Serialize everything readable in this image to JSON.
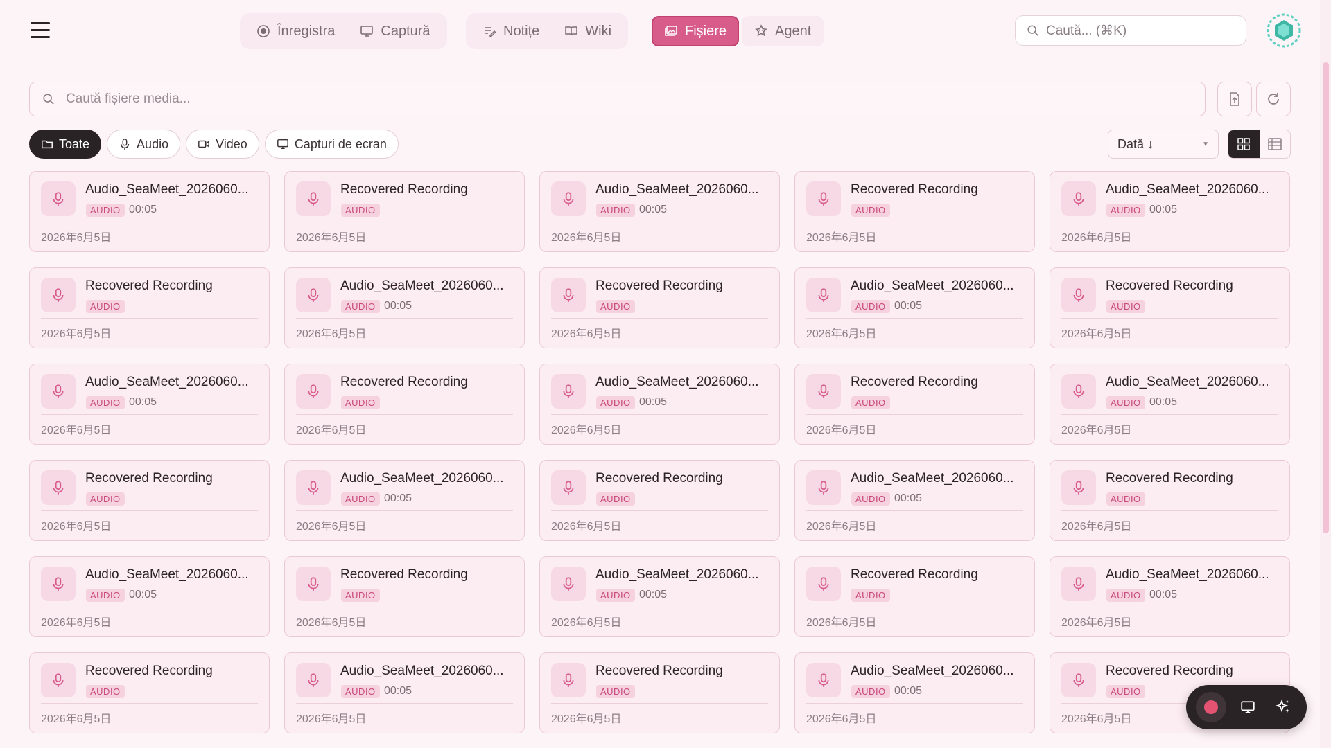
{
  "nav": {
    "groups": [
      [
        {
          "label": "Înregistra",
          "icon": "record-icon"
        },
        {
          "label": "Captură",
          "icon": "monitor-icon"
        }
      ],
      [
        {
          "label": "Notițe",
          "icon": "notes-icon"
        },
        {
          "label": "Wiki",
          "icon": "book-icon"
        }
      ],
      [
        {
          "label": "Fișiere",
          "icon": "folder-images-icon",
          "active": true
        },
        {
          "label": "Agent",
          "icon": "robot-icon"
        }
      ]
    ],
    "search_placeholder": "Caută... (⌘K)"
  },
  "media": {
    "search_placeholder": "Caută fișiere media...",
    "filters": [
      {
        "label": "Toate",
        "icon": "folder-icon",
        "active": true
      },
      {
        "label": "Audio",
        "icon": "mic-icon"
      },
      {
        "label": "Video",
        "icon": "video-icon"
      },
      {
        "label": "Capturi de ecran",
        "icon": "monitor-icon"
      }
    ],
    "sort_label": "Dată ↓",
    "view_modes": [
      "grid",
      "list"
    ],
    "active_view": "grid"
  },
  "files": [
    {
      "title": "Audio_SeaMeet_2026060...",
      "type": "AUDIO",
      "duration": "00:05",
      "date": "2026年6月5日"
    },
    {
      "title": "Recovered Recording",
      "type": "AUDIO",
      "duration": "",
      "date": "2026年6月5日"
    },
    {
      "title": "Audio_SeaMeet_2026060...",
      "type": "AUDIO",
      "duration": "00:05",
      "date": "2026年6月5日"
    },
    {
      "title": "Recovered Recording",
      "type": "AUDIO",
      "duration": "",
      "date": "2026年6月5日"
    },
    {
      "title": "Audio_SeaMeet_2026060...",
      "type": "AUDIO",
      "duration": "00:05",
      "date": "2026年6月5日"
    },
    {
      "title": "Recovered Recording",
      "type": "AUDIO",
      "duration": "",
      "date": "2026年6月5日"
    },
    {
      "title": "Audio_SeaMeet_2026060...",
      "type": "AUDIO",
      "duration": "00:05",
      "date": "2026年6月5日"
    },
    {
      "title": "Recovered Recording",
      "type": "AUDIO",
      "duration": "",
      "date": "2026年6月5日"
    },
    {
      "title": "Audio_SeaMeet_2026060...",
      "type": "AUDIO",
      "duration": "00:05",
      "date": "2026年6月5日"
    },
    {
      "title": "Recovered Recording",
      "type": "AUDIO",
      "duration": "",
      "date": "2026年6月5日"
    },
    {
      "title": "Audio_SeaMeet_2026060...",
      "type": "AUDIO",
      "duration": "00:05",
      "date": "2026年6月5日"
    },
    {
      "title": "Recovered Recording",
      "type": "AUDIO",
      "duration": "",
      "date": "2026年6月5日"
    },
    {
      "title": "Audio_SeaMeet_2026060...",
      "type": "AUDIO",
      "duration": "00:05",
      "date": "2026年6月5日"
    },
    {
      "title": "Recovered Recording",
      "type": "AUDIO",
      "duration": "",
      "date": "2026年6月5日"
    },
    {
      "title": "Audio_SeaMeet_2026060...",
      "type": "AUDIO",
      "duration": "00:05",
      "date": "2026年6月5日"
    },
    {
      "title": "Recovered Recording",
      "type": "AUDIO",
      "duration": "",
      "date": "2026年6月5日"
    },
    {
      "title": "Audio_SeaMeet_2026060...",
      "type": "AUDIO",
      "duration": "00:05",
      "date": "2026年6月5日"
    },
    {
      "title": "Recovered Recording",
      "type": "AUDIO",
      "duration": "",
      "date": "2026年6月5日"
    },
    {
      "title": "Audio_SeaMeet_2026060...",
      "type": "AUDIO",
      "duration": "00:05",
      "date": "2026年6月5日"
    },
    {
      "title": "Recovered Recording",
      "type": "AUDIO",
      "duration": "",
      "date": "2026年6月5日"
    },
    {
      "title": "Audio_SeaMeet_2026060...",
      "type": "AUDIO",
      "duration": "00:05",
      "date": "2026年6月5日"
    },
    {
      "title": "Recovered Recording",
      "type": "AUDIO",
      "duration": "",
      "date": "2026年6月5日"
    },
    {
      "title": "Audio_SeaMeet_2026060...",
      "type": "AUDIO",
      "duration": "00:05",
      "date": "2026年6月5日"
    },
    {
      "title": "Recovered Recording",
      "type": "AUDIO",
      "duration": "",
      "date": "2026年6月5日"
    },
    {
      "title": "Audio_SeaMeet_2026060...",
      "type": "AUDIO",
      "duration": "00:05",
      "date": "2026年6月5日"
    },
    {
      "title": "Recovered Recording",
      "type": "AUDIO",
      "duration": "",
      "date": "2026年6月5日"
    },
    {
      "title": "Audio_SeaMeet_2026060...",
      "type": "AUDIO",
      "duration": "00:05",
      "date": "2026年6月5日"
    },
    {
      "title": "Recovered Recording",
      "type": "AUDIO",
      "duration": "",
      "date": "2026年6月5日"
    },
    {
      "title": "Audio_SeaMeet_2026060...",
      "type": "AUDIO",
      "duration": "00:05",
      "date": "2026年6月5日"
    },
    {
      "title": "Recovered Recording",
      "type": "AUDIO",
      "duration": "",
      "date": "2026年6月5日"
    }
  ],
  "floating_toolbar": {
    "buttons": [
      "record-icon",
      "monitor-icon",
      "sparkles-icon"
    ]
  },
  "colors": {
    "accent": "#d85c8a",
    "background": "#fdf4f8",
    "card": "#fcedf3",
    "dark": "#2a2326"
  }
}
